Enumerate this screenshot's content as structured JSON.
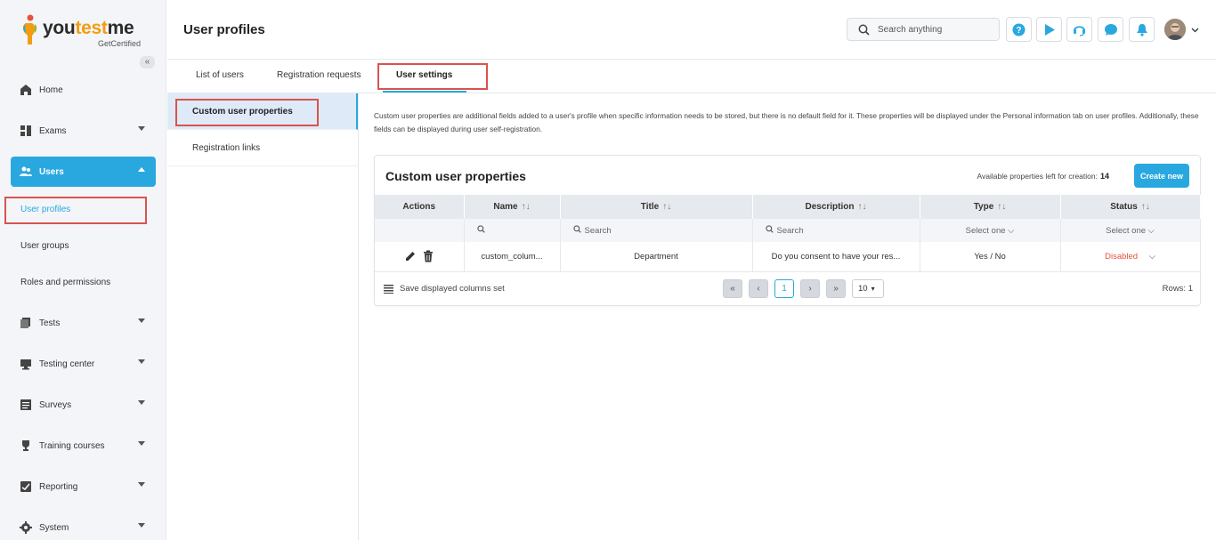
{
  "brand": {
    "name_part1": "you",
    "name_part2": "test",
    "name_part3": "me",
    "tagline": "GetCertified",
    "accent": "#f39c12"
  },
  "sidebar": {
    "collapse": "«",
    "items": [
      {
        "label": "Home"
      },
      {
        "label": "Exams"
      },
      {
        "label": "Users"
      },
      {
        "label": "Tests"
      },
      {
        "label": "Testing center"
      },
      {
        "label": "Surveys"
      },
      {
        "label": "Training courses"
      },
      {
        "label": "Reporting"
      },
      {
        "label": "System"
      }
    ],
    "users_sub": [
      {
        "label": "User profiles"
      },
      {
        "label": "User groups"
      },
      {
        "label": "Roles and permissions"
      }
    ]
  },
  "header": {
    "title": "User profiles",
    "search_placeholder": "Search anything",
    "accent": "#29a8e0"
  },
  "tabs": [
    {
      "label": "List of users"
    },
    {
      "label": "Registration requests"
    },
    {
      "label": "User settings"
    }
  ],
  "subnav": [
    {
      "label": "Custom user properties"
    },
    {
      "label": "Registration links"
    }
  ],
  "main": {
    "description": "Custom user properties are additional fields added to a user's profile when specific information needs to be stored, but there is no default field for it. These properties will be displayed under the Personal information tab on user profiles. Additionally, these fields can be displayed during user self-registration.",
    "card_title": "Custom user properties",
    "available_label": "Available properties left for creation:",
    "available_count": "14",
    "create_button": "Create new",
    "columns": [
      "Actions",
      "Name",
      "Title",
      "Description",
      "Type",
      "Status"
    ],
    "filters": {
      "name": "",
      "title": "Search",
      "description": "Search",
      "type": "Select one",
      "status": "Select one"
    },
    "rows": [
      {
        "name": "custom_colum...",
        "title": "Department",
        "description": "Do you consent to have your res...",
        "type": "Yes / No",
        "status": "Disabled"
      }
    ],
    "save_columns": "Save displayed columns set",
    "current_page": "1",
    "page_size": "10",
    "rows_count": "Rows: 1"
  }
}
